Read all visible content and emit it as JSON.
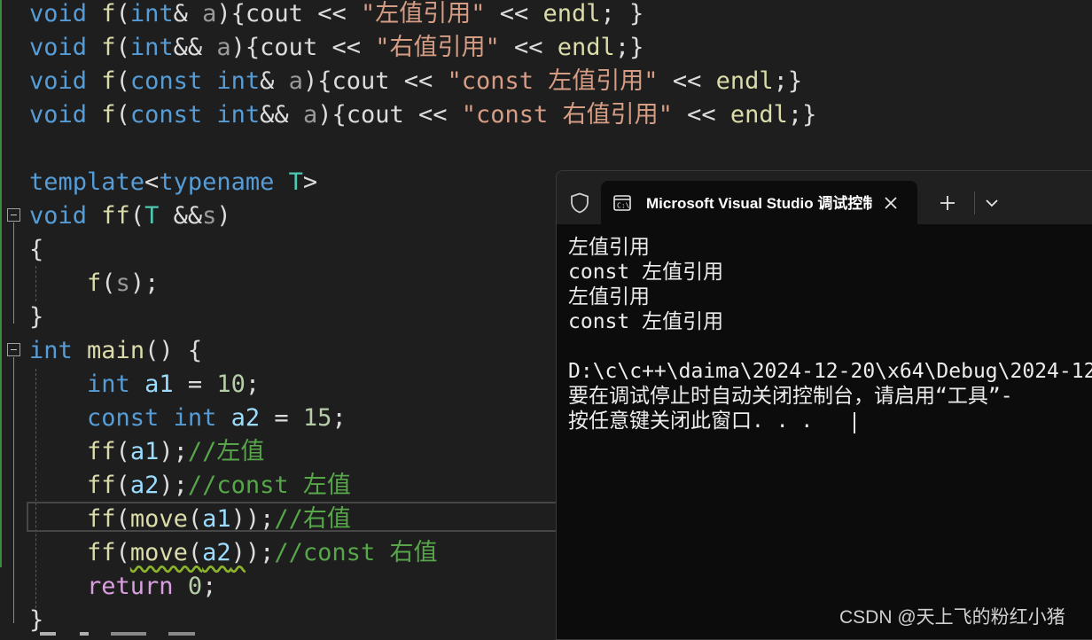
{
  "editor": {
    "lines": [
      {
        "tokens": [
          {
            "t": "void",
            "c": "kw"
          },
          {
            "t": " ",
            "c": "pl"
          },
          {
            "t": "f",
            "c": "fn"
          },
          {
            "t": "(",
            "c": "pl"
          },
          {
            "t": "int",
            "c": "kw"
          },
          {
            "t": "& ",
            "c": "pl"
          },
          {
            "t": "a",
            "c": "prm"
          },
          {
            "t": "){",
            "c": "pl"
          },
          {
            "t": "cout",
            "c": "pl"
          },
          {
            "t": " << ",
            "c": "pl"
          },
          {
            "t": "\"左值引用\"",
            "c": "str"
          },
          {
            "t": " << ",
            "c": "pl"
          },
          {
            "t": "endl",
            "c": "fn"
          },
          {
            "t": "; }",
            "c": "pl"
          }
        ]
      },
      {
        "tokens": [
          {
            "t": "void",
            "c": "kw"
          },
          {
            "t": " ",
            "c": "pl"
          },
          {
            "t": "f",
            "c": "fn"
          },
          {
            "t": "(",
            "c": "pl"
          },
          {
            "t": "int",
            "c": "kw"
          },
          {
            "t": "&& ",
            "c": "pl"
          },
          {
            "t": "a",
            "c": "prm"
          },
          {
            "t": "){",
            "c": "pl"
          },
          {
            "t": "cout",
            "c": "pl"
          },
          {
            "t": " << ",
            "c": "pl"
          },
          {
            "t": "\"右值引用\"",
            "c": "str"
          },
          {
            "t": " << ",
            "c": "pl"
          },
          {
            "t": "endl",
            "c": "fn"
          },
          {
            "t": ";}",
            "c": "pl"
          }
        ]
      },
      {
        "tokens": [
          {
            "t": "void",
            "c": "kw"
          },
          {
            "t": " ",
            "c": "pl"
          },
          {
            "t": "f",
            "c": "fn"
          },
          {
            "t": "(",
            "c": "pl"
          },
          {
            "t": "const",
            "c": "kw"
          },
          {
            "t": " ",
            "c": "pl"
          },
          {
            "t": "int",
            "c": "kw"
          },
          {
            "t": "& ",
            "c": "pl"
          },
          {
            "t": "a",
            "c": "prm"
          },
          {
            "t": "){",
            "c": "pl"
          },
          {
            "t": "cout",
            "c": "pl"
          },
          {
            "t": " << ",
            "c": "pl"
          },
          {
            "t": "\"const 左值引用\"",
            "c": "str"
          },
          {
            "t": " << ",
            "c": "pl"
          },
          {
            "t": "endl",
            "c": "fn"
          },
          {
            "t": ";}",
            "c": "pl"
          }
        ]
      },
      {
        "tokens": [
          {
            "t": "void",
            "c": "kw"
          },
          {
            "t": " ",
            "c": "pl"
          },
          {
            "t": "f",
            "c": "fn"
          },
          {
            "t": "(",
            "c": "pl"
          },
          {
            "t": "const",
            "c": "kw"
          },
          {
            "t": " ",
            "c": "pl"
          },
          {
            "t": "int",
            "c": "kw"
          },
          {
            "t": "&& ",
            "c": "pl"
          },
          {
            "t": "a",
            "c": "prm"
          },
          {
            "t": "){",
            "c": "pl"
          },
          {
            "t": "cout",
            "c": "pl"
          },
          {
            "t": " << ",
            "c": "pl"
          },
          {
            "t": "\"const 右值引用\"",
            "c": "str"
          },
          {
            "t": " << ",
            "c": "pl"
          },
          {
            "t": "endl",
            "c": "fn"
          },
          {
            "t": ";}",
            "c": "pl"
          }
        ]
      },
      {
        "tokens": []
      },
      {
        "tokens": [
          {
            "t": "template",
            "c": "kw"
          },
          {
            "t": "<",
            "c": "pl"
          },
          {
            "t": "typename",
            "c": "kw"
          },
          {
            "t": " ",
            "c": "pl"
          },
          {
            "t": "T",
            "c": "ty"
          },
          {
            "t": ">",
            "c": "pl"
          }
        ]
      },
      {
        "tokens": [
          {
            "t": "void",
            "c": "kw"
          },
          {
            "t": " ",
            "c": "pl"
          },
          {
            "t": "ff",
            "c": "fn"
          },
          {
            "t": "(",
            "c": "pl"
          },
          {
            "t": "T",
            "c": "ty"
          },
          {
            "t": " &&",
            "c": "pl"
          },
          {
            "t": "s",
            "c": "prm"
          },
          {
            "t": ")",
            "c": "pl"
          }
        ]
      },
      {
        "tokens": [
          {
            "t": "{",
            "c": "pl"
          }
        ]
      },
      {
        "tokens": [
          {
            "t": "    ",
            "c": "pl"
          },
          {
            "t": "f",
            "c": "fn"
          },
          {
            "t": "(",
            "c": "pl"
          },
          {
            "t": "s",
            "c": "prm"
          },
          {
            "t": ");",
            "c": "pl"
          }
        ]
      },
      {
        "tokens": [
          {
            "t": "}",
            "c": "pl"
          }
        ]
      },
      {
        "tokens": [
          {
            "t": "int",
            "c": "kw"
          },
          {
            "t": " ",
            "c": "pl"
          },
          {
            "t": "main",
            "c": "fn"
          },
          {
            "t": "() {",
            "c": "pl"
          }
        ]
      },
      {
        "tokens": [
          {
            "t": "    ",
            "c": "pl"
          },
          {
            "t": "int",
            "c": "kw"
          },
          {
            "t": " ",
            "c": "pl"
          },
          {
            "t": "a1",
            "c": "var"
          },
          {
            "t": " = ",
            "c": "pl"
          },
          {
            "t": "10",
            "c": "num"
          },
          {
            "t": ";",
            "c": "pl"
          }
        ]
      },
      {
        "tokens": [
          {
            "t": "    ",
            "c": "pl"
          },
          {
            "t": "const",
            "c": "kw"
          },
          {
            "t": " ",
            "c": "pl"
          },
          {
            "t": "int",
            "c": "kw"
          },
          {
            "t": " ",
            "c": "pl"
          },
          {
            "t": "a2",
            "c": "var"
          },
          {
            "t": " = ",
            "c": "pl"
          },
          {
            "t": "15",
            "c": "num"
          },
          {
            "t": ";",
            "c": "pl"
          }
        ]
      },
      {
        "tokens": [
          {
            "t": "    ",
            "c": "pl"
          },
          {
            "t": "ff",
            "c": "fn"
          },
          {
            "t": "(",
            "c": "pl"
          },
          {
            "t": "a1",
            "c": "var"
          },
          {
            "t": ");",
            "c": "pl"
          },
          {
            "t": "//左值",
            "c": "com"
          }
        ]
      },
      {
        "tokens": [
          {
            "t": "    ",
            "c": "pl"
          },
          {
            "t": "ff",
            "c": "fn"
          },
          {
            "t": "(",
            "c": "pl"
          },
          {
            "t": "a2",
            "c": "var"
          },
          {
            "t": ");",
            "c": "pl"
          },
          {
            "t": "//const 左值",
            "c": "com"
          }
        ]
      },
      {
        "tokens": [
          {
            "t": "    ",
            "c": "pl"
          },
          {
            "t": "ff",
            "c": "fn"
          },
          {
            "t": "(",
            "c": "pl"
          },
          {
            "t": "move",
            "c": "fn"
          },
          {
            "t": "(",
            "c": "pl"
          },
          {
            "t": "a1",
            "c": "var"
          },
          {
            "t": "));",
            "c": "pl"
          },
          {
            "t": "//右值",
            "c": "com"
          }
        ]
      },
      {
        "tokens": [
          {
            "t": "    ",
            "c": "pl"
          },
          {
            "t": "ff",
            "c": "fn"
          },
          {
            "t": "(",
            "c": "pl"
          },
          {
            "t": "move",
            "c": "fn",
            "sq": true
          },
          {
            "t": "(",
            "c": "pl",
            "sq": true
          },
          {
            "t": "a2",
            "c": "var",
            "sq": true
          },
          {
            "t": ")",
            "c": "pl",
            "sq": true
          },
          {
            "t": ");",
            "c": "pl"
          },
          {
            "t": "//const 右值",
            "c": "com"
          }
        ]
      },
      {
        "tokens": [
          {
            "t": "    ",
            "c": "pl"
          },
          {
            "t": "return",
            "c": "kw2"
          },
          {
            "t": " ",
            "c": "pl"
          },
          {
            "t": "0",
            "c": "num"
          },
          {
            "t": ";",
            "c": "pl"
          }
        ]
      },
      {
        "tokens": [
          {
            "t": "}",
            "c": "pl"
          }
        ]
      }
    ]
  },
  "console": {
    "tab_title": "Microsoft Visual Studio 调试控制台",
    "icons": {
      "shield": "shield-icon",
      "tab": "terminal-icon",
      "close": "close-icon",
      "new_tab": "plus-icon",
      "dropdown": "chevron-down-icon"
    },
    "output": [
      "左值引用",
      "const 左值引用",
      "左值引用",
      "const 左值引用",
      "",
      "D:\\c\\c++\\daima\\2024-12-20\\x64\\Debug\\2024-12",
      "要在调试停止时自动关闭控制台，请启用“工具”-",
      "按任意键关闭此窗口. . ."
    ]
  },
  "watermark": "CSDN @天上飞的粉红小猪",
  "colors": {
    "editor_bg": "#1e1e1e",
    "keyword": "#569cd6",
    "control_keyword": "#d8a0df",
    "type": "#4ec9b0",
    "function": "#dcdcaa",
    "string": "#d69d85",
    "variable": "#9cdcfe",
    "number": "#b5cea8",
    "comment": "#57a64a",
    "console_bg": "#0c0c0c",
    "titlebar_bg": "#202020"
  }
}
